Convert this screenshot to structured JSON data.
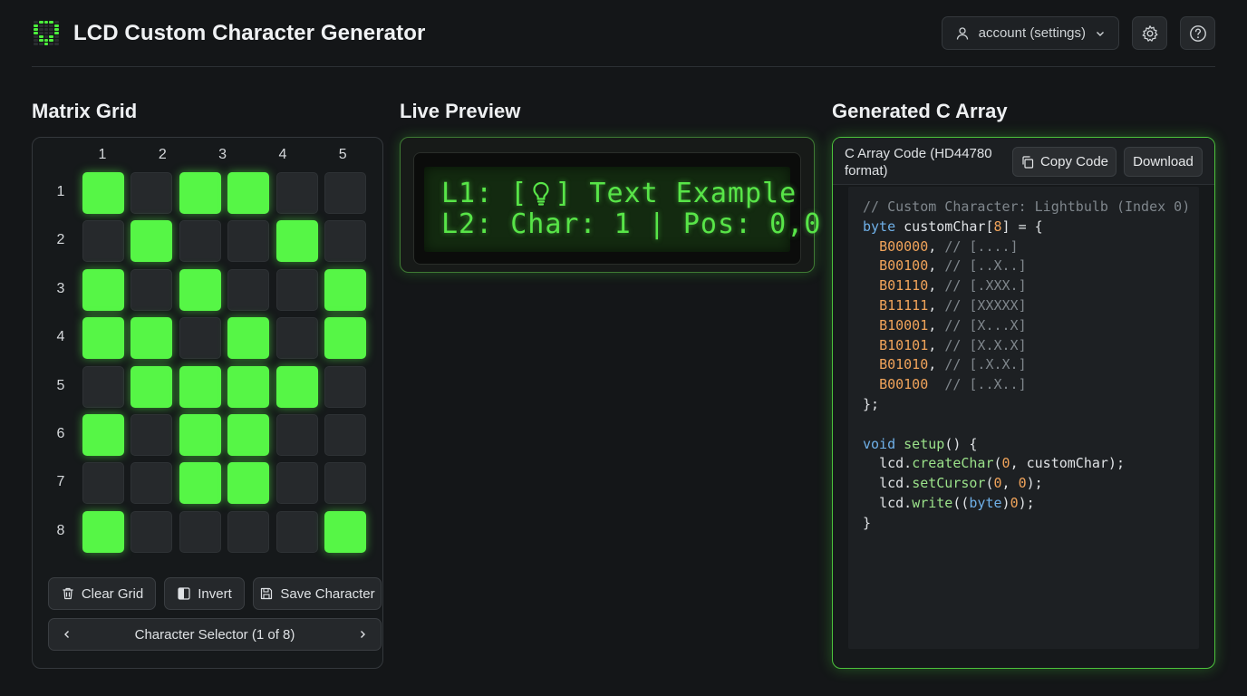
{
  "header": {
    "title": "LCD Custom Character Generator",
    "account_label": "account (settings)",
    "logo_pattern": [
      [
        0,
        1,
        1,
        1,
        0
      ],
      [
        1,
        0,
        0,
        0,
        1
      ],
      [
        1,
        0,
        0,
        0,
        1
      ],
      [
        1,
        0,
        0,
        0,
        1
      ],
      [
        0,
        1,
        0,
        1,
        0
      ],
      [
        0,
        1,
        1,
        1,
        0
      ],
      [
        0,
        0,
        1,
        0,
        0
      ]
    ]
  },
  "matrix": {
    "title": "Matrix Grid",
    "columns": [
      "1",
      "2",
      "3",
      "4",
      "5"
    ],
    "rows": [
      "1",
      "2",
      "3",
      "4",
      "5",
      "6",
      "7",
      "8"
    ],
    "cells": [
      [
        1,
        0,
        1,
        1,
        0,
        0
      ],
      [
        0,
        1,
        0,
        0,
        1,
        0
      ],
      [
        1,
        0,
        1,
        0,
        0,
        1
      ],
      [
        1,
        1,
        0,
        1,
        0,
        1
      ],
      [
        0,
        1,
        1,
        1,
        1,
        0
      ],
      [
        1,
        0,
        1,
        1,
        0,
        0
      ],
      [
        0,
        0,
        1,
        1,
        0,
        0
      ],
      [
        1,
        0,
        0,
        0,
        0,
        1
      ]
    ],
    "clear_label": "Clear Grid",
    "invert_label": "Invert",
    "save_label": "Save Character",
    "selector_label": "Character Selector (1 of 8)",
    "on_color": "#56f646",
    "off_color": "#26292c"
  },
  "preview": {
    "title": "Live Preview",
    "line1_prefix": "L1: [",
    "line1_suffix": "] Text Example",
    "line2": "L2: Char: 1 | Pos: 0,0",
    "lcd_color": "#58e548"
  },
  "code": {
    "title": "Generated C Array",
    "header_label": "C Array Code (HD44780 format)",
    "copy_label": "Copy Code",
    "download_label": "Download",
    "comment_line": "// Custom Character: Lightbulb (Index 0)",
    "decl_kw": "byte",
    "decl_name": " customChar[",
    "decl_size": "8",
    "decl_end": "] = {",
    "array_rows": [
      {
        "value": "B00000",
        "sep": ",",
        "comment": "// [....]"
      },
      {
        "value": "B00100",
        "sep": ",",
        "comment": "// [..X..]"
      },
      {
        "value": "B01110",
        "sep": ",",
        "comment": "// [.XXX.]"
      },
      {
        "value": "B11111",
        "sep": ",",
        "comment": "// [XXXXX]"
      },
      {
        "value": "B10001",
        "sep": ",",
        "comment": "// [X...X]"
      },
      {
        "value": "B10101",
        "sep": ",",
        "comment": "// [X.X.X]"
      },
      {
        "value": "B01010",
        "sep": ",",
        "comment": "// [.X.X.]"
      },
      {
        "value": "B00100",
        "sep": " ",
        "comment": "// [..X..]"
      }
    ],
    "close_array": "};",
    "setup_kw": "void",
    "setup_fn": "setup",
    "setup_open": "() {",
    "l1_obj": "lcd.",
    "l1_fn": "createChar",
    "l1_open": "(",
    "l1_num": "0",
    "l1_rest": ", customChar);",
    "l2_obj": "lcd.",
    "l2_fn": "setCursor",
    "l2_open": "(",
    "l2_num1": "0",
    "l2_mid": ", ",
    "l2_num2": "0",
    "l2_rest": ");",
    "l3_obj": "lcd.",
    "l3_fn": "write",
    "l3_open": "((",
    "l3_kw": "byte",
    "l3_close": ")",
    "l3_num": "0",
    "l3_rest": ");",
    "close_fn": "}"
  }
}
